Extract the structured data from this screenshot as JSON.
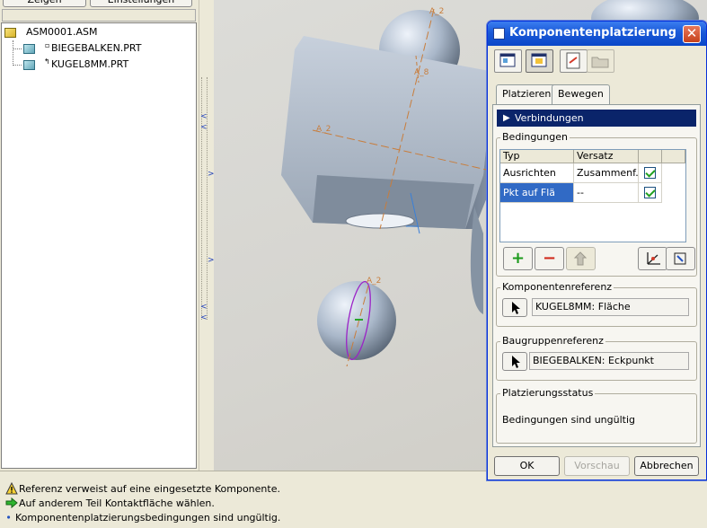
{
  "tree": {
    "tabs": [
      "Zeigen",
      "Einstellungen"
    ],
    "items": [
      {
        "label": "ASM0001.ASM",
        "icon": "assembly-icon"
      },
      {
        "label": "BIEGEBALKEN.PRT",
        "icon": "part-icon"
      },
      {
        "label": "KUGEL8MM.PRT",
        "icon": "part-icon"
      }
    ]
  },
  "viewport": {
    "axis_labels": [
      "A_2",
      "A_2",
      "A_8",
      "A_2"
    ]
  },
  "dialog": {
    "title": "Komponentenplatzierung",
    "close_label": "✕",
    "tabs": [
      "Platzieren",
      "Bewegen"
    ],
    "connections_label": "Verbindungen",
    "constraints_label": "Bedingungen",
    "columns": [
      "Typ",
      "Versatz"
    ],
    "rows": [
      {
        "type": "Ausrichten",
        "offset": "Zusammenf...",
        "checked": true
      },
      {
        "type": "Pkt auf Flä",
        "offset": "--",
        "checked": true
      }
    ],
    "add_label": "+",
    "remove_label": "−",
    "component_ref_label": "Komponentenreferenz",
    "component_ref_value": "KUGEL8MM: Fläche",
    "assembly_ref_label": "Baugruppenreferenz",
    "assembly_ref_value": "BIEGEBALKEN: Eckpunkt",
    "status_label": "Platzierungsstatus",
    "status_text": "Bedingungen sind ungültig",
    "ok_label": "OK",
    "preview_label": "Vorschau",
    "cancel_label": "Abbrechen"
  },
  "messages": [
    {
      "icon": "warning-icon",
      "text": "Referenz verweist auf eine eingesetzte Komponente."
    },
    {
      "icon": "arrow-right-icon",
      "text": "Auf anderem Teil Kontaktfläche wählen."
    },
    {
      "icon": "bullet-icon",
      "text": "Komponentenplatzierungsbedingungen sind ungültig."
    }
  ],
  "colors": {
    "titlebar": "#0b47c8",
    "selection": "#316ac5",
    "connections_bar": "#0a246a",
    "axis": "#c87d3c",
    "sphere_highlight": "#9b22c7"
  }
}
